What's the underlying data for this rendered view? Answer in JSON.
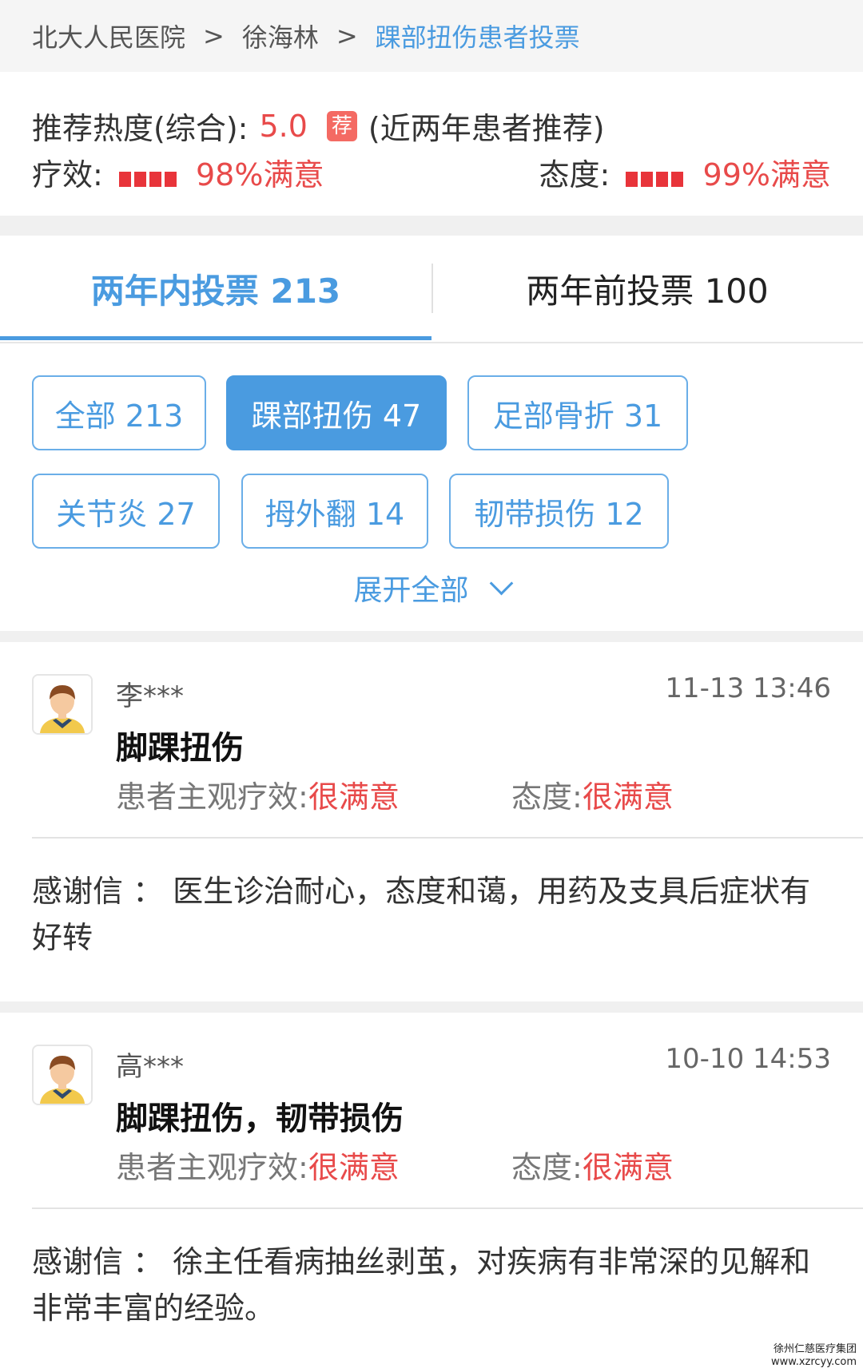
{
  "breadcrumb": {
    "hospital": "北大人民医院",
    "doctor": "徐海林",
    "current": "踝部扭伤患者投票",
    "separator": ">"
  },
  "rating": {
    "heat_label": "推荐热度(综合):",
    "heat_score": "5.0",
    "badge": "荐",
    "heat_note": "(近两年患者推荐)",
    "efficacy_label": "疗效:",
    "efficacy_value": "98%满意",
    "attitude_label": "态度:",
    "attitude_value": "99%满意"
  },
  "tabs": {
    "within_two_years": "两年内投票 213",
    "before_two_years": "两年前投票 100"
  },
  "filters": [
    {
      "label": "全部 213",
      "selected": false
    },
    {
      "label": "踝部扭伤 47",
      "selected": true
    },
    {
      "label": "足部骨折 31",
      "selected": false
    },
    {
      "label": "关节炎 27",
      "selected": false
    },
    {
      "label": "拇外翻 14",
      "selected": false
    },
    {
      "label": "韧带损伤 12",
      "selected": false
    }
  ],
  "expand_all": "展开全部",
  "reviews": [
    {
      "user": "李***",
      "time": "11-13 13:46",
      "title": "脚踝扭伤",
      "efficacy_label": "患者主观疗效:",
      "efficacy_value": "很满意",
      "attitude_label": "态度:",
      "attitude_value": "很满意",
      "letter": "感谢信 ： 医生诊治耐心，态度和蔼，用药及支具后症状有好转"
    },
    {
      "user": "高***",
      "time": "10-10 14:53",
      "title": "脚踝扭伤，韧带损伤",
      "efficacy_label": "患者主观疗效:",
      "efficacy_value": "很满意",
      "attitude_label": "态度:",
      "attitude_value": "很满意",
      "letter": "感谢信 ： 徐主任看病抽丝剥茧，对疾病有非常深的见解和非常丰富的经验。"
    }
  ],
  "watermark": {
    "line1": "徐州仁慈医疗集团",
    "line2": "www.xzrcyy.com"
  },
  "colors": {
    "accent_blue": "#4a9be0",
    "satisfaction_red": "#e84a4a"
  }
}
